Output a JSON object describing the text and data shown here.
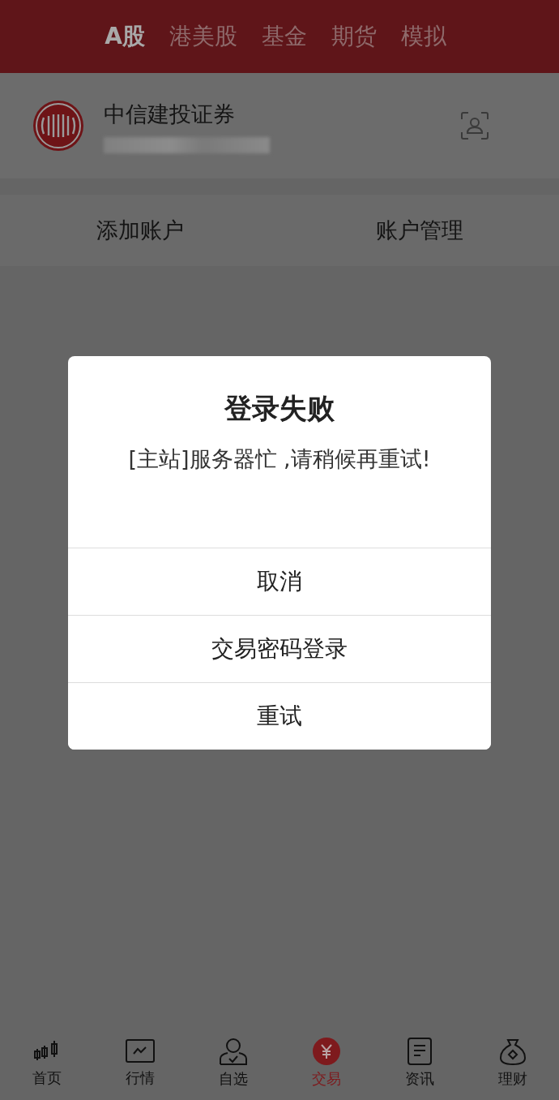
{
  "market_tabs": [
    {
      "label": "A股",
      "selected": true
    },
    {
      "label": "港美股",
      "selected": false
    },
    {
      "label": "基金",
      "selected": false
    },
    {
      "label": "期货",
      "selected": false
    },
    {
      "label": "模拟",
      "selected": false
    }
  ],
  "account": {
    "broker": "中信建投证券"
  },
  "account_actions": [
    "添加账户",
    "账户管理"
  ],
  "dialog": {
    "title": "登录失败",
    "message": "[主站]服务器忙 ,请稍候再重试!",
    "buttons": [
      "取消",
      "交易密码登录",
      "重试"
    ]
  },
  "bottom_nav": [
    {
      "label": "首页",
      "selected": false
    },
    {
      "label": "行情",
      "selected": false
    },
    {
      "label": "自选",
      "selected": false
    },
    {
      "label": "交易",
      "selected": true
    },
    {
      "label": "资讯",
      "selected": false
    },
    {
      "label": "理财",
      "selected": false
    }
  ]
}
